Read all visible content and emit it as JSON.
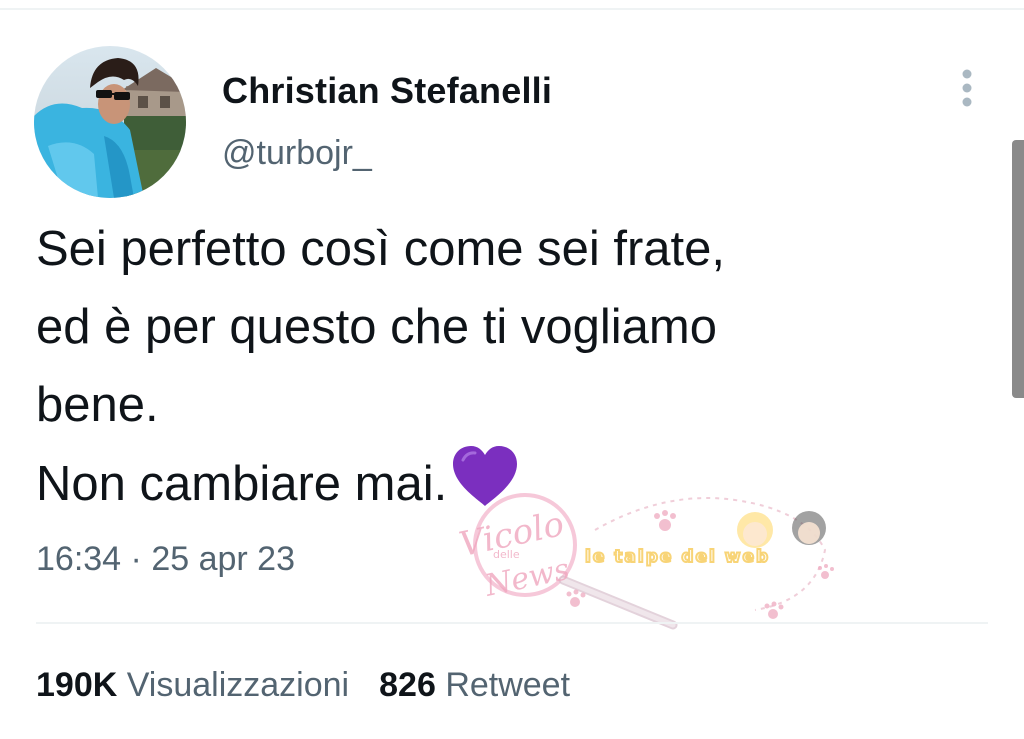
{
  "author": {
    "name": "Christian Stefanelli",
    "handle": "@turbojr_"
  },
  "tweet": {
    "lines": [
      "Sei perfetto così come sei frate,",
      "ed è per questo che ti vogliamo",
      "bene.",
      "Non cambiare mai."
    ],
    "emoji": "purple-heart",
    "time": "16:34",
    "separator": " · ",
    "date": "25 apr 23"
  },
  "stats": {
    "views_count": "190K",
    "views_label": "Visualizzazioni",
    "retweets_count": "826",
    "retweets_label": "Retweet"
  },
  "icons": {
    "more": "more-vertical-icon"
  },
  "colors": {
    "text": "#0f1419",
    "secondary": "#536471",
    "divider": "#eff3f4",
    "heart": "#7b2fbf"
  },
  "watermark": {
    "logo_text": "Vicolo delle News",
    "banner_text": "le talpe del web"
  }
}
